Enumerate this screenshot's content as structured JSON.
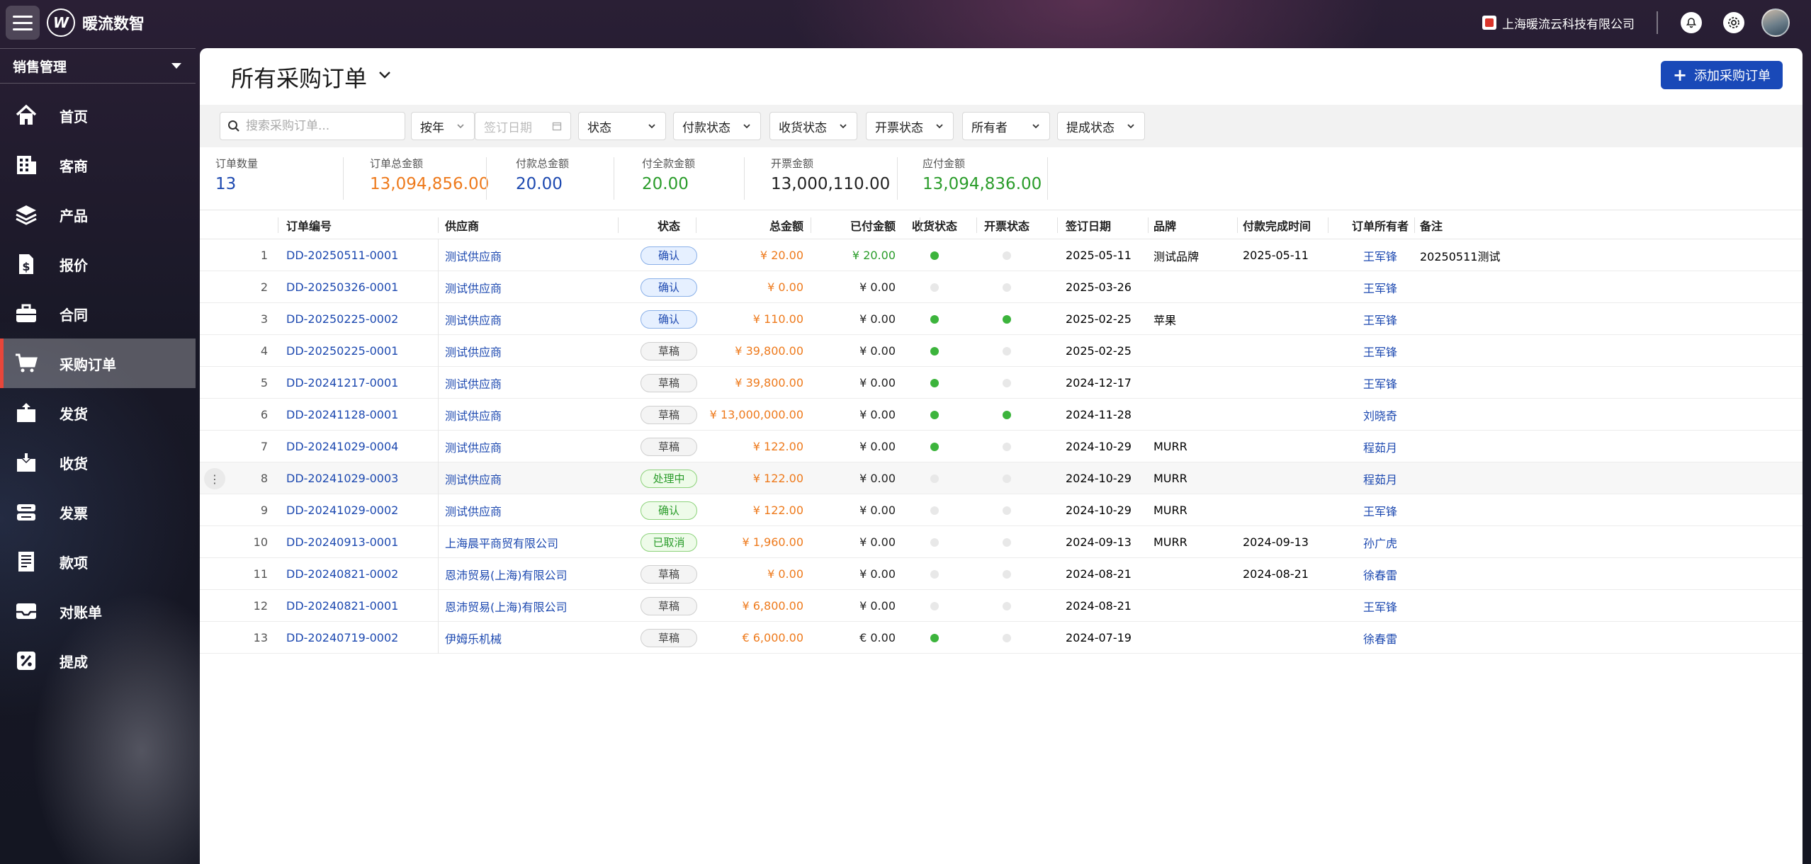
{
  "app": {
    "brand": "暖流数智",
    "company": "上海暖流云科技有限公司"
  },
  "sidebar": {
    "module": "销售管理",
    "items": [
      {
        "label": "首页",
        "icon": "home-icon"
      },
      {
        "label": "客商",
        "icon": "building-icon"
      },
      {
        "label": "产品",
        "icon": "layers-icon"
      },
      {
        "label": "报价",
        "icon": "dollar-doc-icon"
      },
      {
        "label": "合同",
        "icon": "briefcase-icon"
      },
      {
        "label": "采购订单",
        "icon": "cart-icon",
        "active": true
      },
      {
        "label": "发货",
        "icon": "box-out-icon"
      },
      {
        "label": "收货",
        "icon": "box-in-icon"
      },
      {
        "label": "发票",
        "icon": "invoice-icon"
      },
      {
        "label": "款项",
        "icon": "ledger-icon"
      },
      {
        "label": "对账单",
        "icon": "inbox-icon"
      },
      {
        "label": "提成",
        "icon": "percent-icon"
      }
    ]
  },
  "page": {
    "title": "所有采购订单",
    "add_label": "添加采购订单"
  },
  "filters": {
    "search_placeholder": "搜索采购订单...",
    "period": "按年",
    "date_placeholder": "签订日期",
    "status": "状态",
    "payment_status": "付款状态",
    "receive_status": "收货状态",
    "invoice_status": "开票状态",
    "owner": "所有者",
    "commission_status": "提成状态"
  },
  "stats": [
    {
      "label": "订单数量",
      "value": "13",
      "color": "#1d49b0"
    },
    {
      "label": "订单总金额",
      "value": "13,094,856.00",
      "color": "#ee7a1c"
    },
    {
      "label": "付款总金额",
      "value": "20.00",
      "color": "#1d49b0"
    },
    {
      "label": "付全款金额",
      "value": "20.00",
      "color": "#2a9c2a"
    },
    {
      "label": "开票金额",
      "value": "13,000,110.00",
      "color": "#222222"
    },
    {
      "label": "应付金额",
      "value": "13,094,836.00",
      "color": "#2a9c2a"
    }
  ],
  "table": {
    "headers": {
      "order_no": "订单编号",
      "supplier": "供应商",
      "status": "状态",
      "total": "总金额",
      "paid": "已付金额",
      "receive": "收货状态",
      "invoice": "开票状态",
      "date": "签订日期",
      "brand": "品牌",
      "pay_done": "付款完成时间",
      "owner": "订单所有者",
      "remark": "备注"
    },
    "rows": [
      {
        "idx": "1",
        "order_no": "DD-20250511-0001",
        "supplier": "测试供应商",
        "status": "确认",
        "status_type": "confirm",
        "total": "¥ 20.00",
        "paid": "¥ 20.00",
        "paid_green": true,
        "receive": true,
        "invoice": false,
        "date": "2025-05-11",
        "brand": "测试品牌",
        "pay_done": "2025-05-11",
        "owner": "王军锋",
        "remark": "20250511测试"
      },
      {
        "idx": "2",
        "order_no": "DD-20250326-0001",
        "supplier": "测试供应商",
        "status": "确认",
        "status_type": "confirm",
        "total": "¥ 0.00",
        "paid": "¥ 0.00",
        "receive": false,
        "invoice": false,
        "date": "2025-03-26",
        "brand": "",
        "pay_done": "",
        "owner": "王军锋",
        "remark": ""
      },
      {
        "idx": "3",
        "order_no": "DD-20250225-0002",
        "supplier": "测试供应商",
        "status": "确认",
        "status_type": "confirm",
        "total": "¥ 110.00",
        "paid": "¥ 0.00",
        "receive": true,
        "invoice": true,
        "date": "2025-02-25",
        "brand": "苹果",
        "pay_done": "",
        "owner": "王军锋",
        "remark": ""
      },
      {
        "idx": "4",
        "order_no": "DD-20250225-0001",
        "supplier": "测试供应商",
        "status": "草稿",
        "status_type": "draft",
        "total": "¥ 39,800.00",
        "paid": "¥ 0.00",
        "receive": true,
        "invoice": false,
        "date": "2025-02-25",
        "brand": "",
        "pay_done": "",
        "owner": "王军锋",
        "remark": ""
      },
      {
        "idx": "5",
        "order_no": "DD-20241217-0001",
        "supplier": "测试供应商",
        "status": "草稿",
        "status_type": "draft",
        "total": "¥ 39,800.00",
        "paid": "¥ 0.00",
        "receive": true,
        "invoice": false,
        "date": "2024-12-17",
        "brand": "",
        "pay_done": "",
        "owner": "王军锋",
        "remark": ""
      },
      {
        "idx": "6",
        "order_no": "DD-20241128-0001",
        "supplier": "测试供应商",
        "status": "草稿",
        "status_type": "draft",
        "total": "¥ 13,000,000.00",
        "paid": "¥ 0.00",
        "receive": true,
        "invoice": true,
        "date": "2024-11-28",
        "brand": "",
        "pay_done": "",
        "owner": "刘晓奇",
        "remark": ""
      },
      {
        "idx": "7",
        "order_no": "DD-20241029-0004",
        "supplier": "测试供应商",
        "status": "草稿",
        "status_type": "draft",
        "total": "¥ 122.00",
        "paid": "¥ 0.00",
        "receive": true,
        "invoice": false,
        "date": "2024-10-29",
        "brand": "MURR",
        "pay_done": "",
        "owner": "程茹月",
        "remark": ""
      },
      {
        "idx": "8",
        "order_no": "DD-20241029-0003",
        "supplier": "测试供应商",
        "status": "处理中",
        "status_type": "processing",
        "total": "¥ 122.00",
        "paid": "¥ 0.00",
        "receive": false,
        "invoice": false,
        "date": "2024-10-29",
        "brand": "MURR",
        "pay_done": "",
        "owner": "程茹月",
        "remark": "",
        "hover": true
      },
      {
        "idx": "9",
        "order_no": "DD-20241029-0002",
        "supplier": "测试供应商",
        "status": "确认",
        "status_type": "processing",
        "total": "¥ 122.00",
        "paid": "¥ 0.00",
        "receive": false,
        "invoice": false,
        "date": "2024-10-29",
        "brand": "MURR",
        "pay_done": "",
        "owner": "王军锋",
        "remark": ""
      },
      {
        "idx": "10",
        "order_no": "DD-20240913-0001",
        "supplier": "上海晨平商贸有限公司",
        "status": "已取消",
        "status_type": "cancelled",
        "total": "¥ 1,960.00",
        "paid": "¥ 0.00",
        "receive": false,
        "invoice": false,
        "date": "2024-09-13",
        "brand": "MURR",
        "pay_done": "2024-09-13",
        "owner": "孙广虎",
        "remark": ""
      },
      {
        "idx": "11",
        "order_no": "DD-20240821-0002",
        "supplier": "恩沛贸易(上海)有限公司",
        "status": "草稿",
        "status_type": "draft",
        "total": "¥ 0.00",
        "paid": "¥ 0.00",
        "receive": false,
        "invoice": false,
        "date": "2024-08-21",
        "brand": "",
        "pay_done": "2024-08-21",
        "owner": "徐春雷",
        "remark": ""
      },
      {
        "idx": "12",
        "order_no": "DD-20240821-0001",
        "supplier": "恩沛贸易(上海)有限公司",
        "status": "草稿",
        "status_type": "draft",
        "total": "¥ 6,800.00",
        "paid": "¥ 0.00",
        "receive": false,
        "invoice": false,
        "date": "2024-08-21",
        "brand": "",
        "pay_done": "",
        "owner": "王军锋",
        "remark": ""
      },
      {
        "idx": "13",
        "order_no": "DD-20240719-0002",
        "supplier": "伊姆乐机械",
        "status": "草稿",
        "status_type": "draft",
        "total": "€ 6,000.00",
        "paid": "€ 0.00",
        "receive": true,
        "invoice": false,
        "date": "2024-07-19",
        "brand": "",
        "pay_done": "",
        "owner": "徐春雷",
        "remark": ""
      }
    ]
  }
}
